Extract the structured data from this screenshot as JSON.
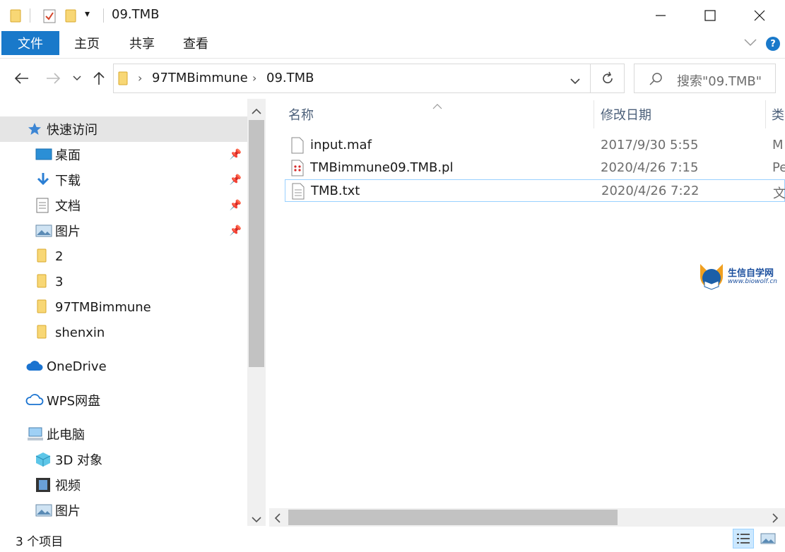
{
  "window": {
    "title": "09.TMB",
    "quick_access_arrow": "▾"
  },
  "ribbon": {
    "tabs": [
      {
        "label": "文件",
        "active": true
      },
      {
        "label": "主页"
      },
      {
        "label": "共享"
      },
      {
        "label": "查看"
      }
    ],
    "help": "?"
  },
  "address": {
    "path": [
      "97TMBimmune",
      "09.TMB"
    ],
    "search_placeholder": "搜索\"09.TMB\""
  },
  "nav": {
    "quick_access": "快速访问",
    "pinned": [
      "桌面",
      "下载",
      "文档",
      "图片"
    ],
    "folders": [
      "2",
      "3",
      "97TMBimmune",
      "shenxin"
    ],
    "onedrive": "OneDrive",
    "wps": "WPS网盘",
    "this_pc": "此电脑",
    "pc_items": [
      "3D 对象",
      "视频",
      "图片"
    ]
  },
  "columns": {
    "name": "名称",
    "date": "修改日期",
    "type": "类"
  },
  "files": [
    {
      "name": "input.maf",
      "date": "2017/9/30 5:55",
      "type": "M"
    },
    {
      "name": "TMBimmune09.TMB.pl",
      "date": "2020/4/26 7:15",
      "type": "Pe"
    },
    {
      "name": "TMB.txt",
      "date": "2020/4/26 7:22",
      "type": "文"
    }
  ],
  "watermark": {
    "name": "生信自学网",
    "url": "www.biowolf.cn"
  },
  "status": {
    "count": "3 个项目"
  },
  "colors": {
    "accent": "#1979ca",
    "folder": "#f8d775",
    "selection": "#cce8ff"
  }
}
